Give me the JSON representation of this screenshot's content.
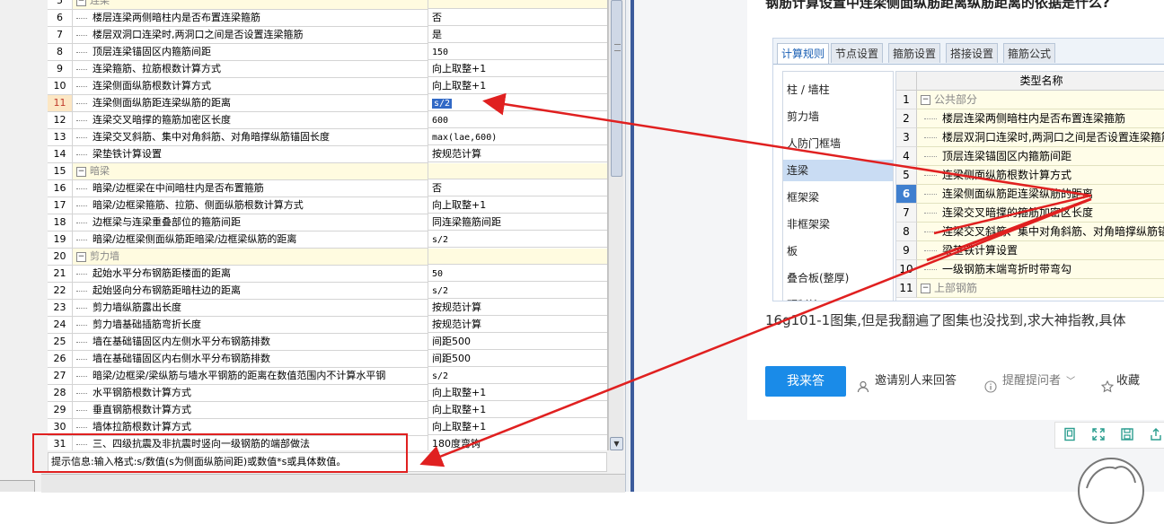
{
  "settings_grid": {
    "rows": [
      {
        "num": "5",
        "name": "连梁",
        "value": "",
        "type": "cat"
      },
      {
        "num": "6",
        "name": "楼层连梁两侧暗柱内是否布置连梁箍筋",
        "value": "否"
      },
      {
        "num": "7",
        "name": "楼层双洞口连梁时,两洞口之间是否设置连梁箍筋",
        "value": "是"
      },
      {
        "num": "8",
        "name": "顶层连梁锚固区内箍筋间距",
        "value": "150"
      },
      {
        "num": "9",
        "name": "连梁箍筋、拉筋根数计算方式",
        "value": "向上取整+1"
      },
      {
        "num": "10",
        "name": "连梁侧面纵筋根数计算方式",
        "value": "向上取整+1"
      },
      {
        "num": "11",
        "name": "连梁侧面纵筋距连梁纵筋的距离",
        "value": "s/2",
        "selected": true
      },
      {
        "num": "12",
        "name": "连梁交叉暗撑的箍筋加密区长度",
        "value": "600"
      },
      {
        "num": "13",
        "name": "连梁交叉斜筋、集中对角斜筋、对角暗撑纵筋锚固长度",
        "value": "max(lae,600)"
      },
      {
        "num": "14",
        "name": "梁垫铁计算设置",
        "value": "按规范计算"
      },
      {
        "num": "15",
        "name": "暗梁",
        "value": "",
        "type": "cat"
      },
      {
        "num": "16",
        "name": "暗梁/边框梁在中间暗柱内是否布置箍筋",
        "value": "否"
      },
      {
        "num": "17",
        "name": "暗梁/边框梁箍筋、拉筋、侧面纵筋根数计算方式",
        "value": "向上取整+1"
      },
      {
        "num": "18",
        "name": "边框梁与连梁重叠部位的箍筋间距",
        "value": "同连梁箍筋间距"
      },
      {
        "num": "19",
        "name": "暗梁/边框梁侧面纵筋距暗梁/边框梁纵筋的距离",
        "value": "s/2"
      },
      {
        "num": "20",
        "name": "剪力墙",
        "value": "",
        "type": "cat"
      },
      {
        "num": "21",
        "name": "起始水平分布钢筋距楼面的距离",
        "value": "50"
      },
      {
        "num": "22",
        "name": "起始竖向分布钢筋距暗柱边的距离",
        "value": "s/2"
      },
      {
        "num": "23",
        "name": "剪力墙纵筋露出长度",
        "value": "按规范计算"
      },
      {
        "num": "24",
        "name": "剪力墙基础插筋弯折长度",
        "value": "按规范计算"
      },
      {
        "num": "25",
        "name": "墙在基础锚固区内左侧水平分布钢筋排数",
        "value": "间距500"
      },
      {
        "num": "26",
        "name": "墙在基础锚固区内右侧水平分布钢筋排数",
        "value": "间距500"
      },
      {
        "num": "27",
        "name": "暗梁/边框梁/梁纵筋与墙水平钢筋的距离在数值范围内不计算水平钢",
        "value": "s/2"
      },
      {
        "num": "28",
        "name": "水平钢筋根数计算方式",
        "value": "向上取整+1"
      },
      {
        "num": "29",
        "name": "垂直钢筋根数计算方式",
        "value": "向上取整+1"
      },
      {
        "num": "30",
        "name": "墙体拉筋根数计算方式",
        "value": "向上取整+1"
      },
      {
        "num": "31",
        "name": "三、四级抗震及非抗震时竖向一级钢筋的端部做法",
        "value": "180度弯钩"
      }
    ],
    "hint": "提示信息:输入格式:s/数值(s为侧面纵筋间距)或数值*s或具体数值。"
  },
  "question": {
    "title": "钢筋计算设置中连梁侧面纵筋距离纵筋距离的依据是什么?",
    "description": "16g101-1图集,但是我翻遍了图集也没找到,求大神指教,具体",
    "embedded_tabs": [
      "计算规则",
      "节点设置",
      "箍筋设置",
      "搭接设置",
      "箍筋公式"
    ],
    "embedded_categories": [
      "柱 / 墙柱",
      "剪力墙",
      "人防门框墙",
      "连梁",
      "框架梁",
      "非框架梁",
      "板",
      "叠合板(整厚)",
      "预制柱"
    ],
    "embedded_table_header": "类型名称",
    "embedded_rows": [
      {
        "num": "1",
        "text": "公共部分",
        "type": "cat"
      },
      {
        "num": "2",
        "text": "楼层连梁两侧暗柱内是否布置连梁箍筋"
      },
      {
        "num": "3",
        "text": "楼层双洞口连梁时,两洞口之间是否设置连梁箍筋"
      },
      {
        "num": "4",
        "text": "顶层连梁锚固区内箍筋间距"
      },
      {
        "num": "5",
        "text": "连梁侧面纵筋根数计算方式"
      },
      {
        "num": "6",
        "text": "连梁侧面纵筋距连梁纵筋的距离",
        "selected": true
      },
      {
        "num": "7",
        "text": "连梁交叉暗撑的箍筋加密区长度"
      },
      {
        "num": "8",
        "text": "连梁交叉斜筋、集中对角斜筋、对角暗撑纵筋锚"
      },
      {
        "num": "9",
        "text": "梁垫铁计算设置"
      },
      {
        "num": "10",
        "text": "一级钢筋末端弯折时带弯勾"
      },
      {
        "num": "11",
        "text": "上部钢筋",
        "type": "cat"
      }
    ],
    "answer_button": "我来答",
    "invite_label": "邀请别人来回答",
    "remind_label": "提醒提问者",
    "collect_label": "收藏"
  },
  "colors": {
    "accent": "#1a8be8",
    "annotation": "#e02020",
    "selection": "#3169c6"
  }
}
